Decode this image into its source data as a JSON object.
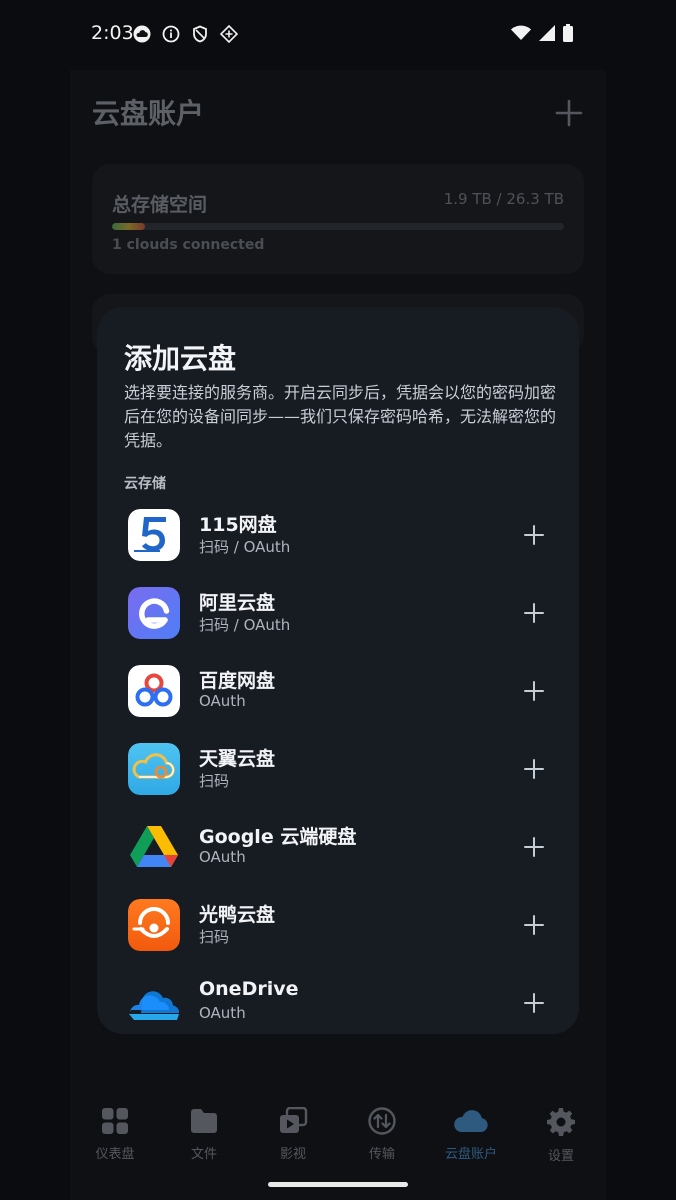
{
  "status_bar": {
    "time": "2:03"
  },
  "app": {
    "title": "云盘账户",
    "storage": {
      "label": "总存储空间",
      "value": "1.9 TB / 26.3 TB",
      "used_fraction": 0.072,
      "connected": "1 clouds connected"
    }
  },
  "sheet": {
    "title": "添加云盘",
    "description": "选择要连接的服务商。开启云同步后，凭据会以您的密码加密后在您的设备间同步——我们只保存密码哈希，无法解密您的凭据。",
    "section_label": "云存储",
    "providers": [
      {
        "name": "115网盘",
        "methods": "扫码 / OAuth",
        "icon": "115-logo-icon"
      },
      {
        "name": "阿里云盘",
        "methods": "扫码 / OAuth",
        "icon": "aliyun-logo-icon"
      },
      {
        "name": "百度网盘",
        "methods": "OAuth",
        "icon": "baidu-logo-icon"
      },
      {
        "name": "天翼云盘",
        "methods": "扫码",
        "icon": "tianyi-logo-icon"
      },
      {
        "name": "Google 云端硬盘",
        "methods": "OAuth",
        "icon": "google-drive-logo-icon"
      },
      {
        "name": "光鸭云盘",
        "methods": "扫码",
        "icon": "guangya-logo-icon"
      },
      {
        "name": "OneDrive",
        "methods": "OAuth",
        "icon": "onedrive-logo-icon"
      }
    ]
  },
  "bottom_nav": {
    "items": [
      {
        "label": "仪表盘",
        "icon": "dashboard-icon"
      },
      {
        "label": "文件",
        "icon": "folder-icon"
      },
      {
        "label": "影视",
        "icon": "video-icon"
      },
      {
        "label": "传输",
        "icon": "transfer-icon"
      },
      {
        "label": "云盘账户",
        "icon": "cloud-icon",
        "active": true
      },
      {
        "label": "设置",
        "icon": "settings-gear-icon"
      }
    ]
  },
  "colors": {
    "sheet_background": "#171b22",
    "active_nav": "#2f5a80",
    "page_background": "#0b0c0f"
  }
}
